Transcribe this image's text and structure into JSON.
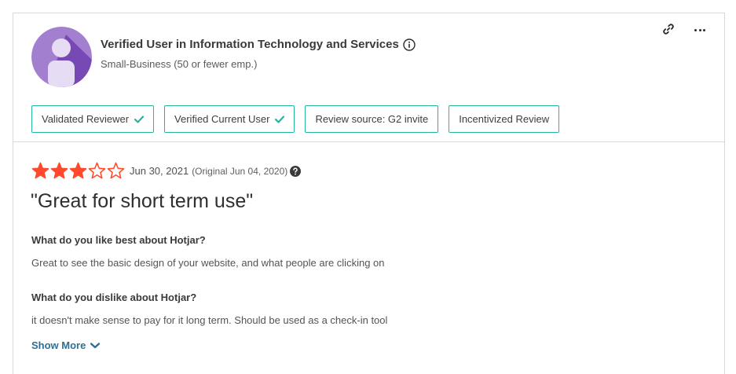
{
  "reviewer": {
    "name": "Verified User in Information Technology and Services",
    "segment": "Small-Business (50 or fewer emp.)"
  },
  "badges": [
    {
      "label": "Validated Reviewer",
      "checked": true
    },
    {
      "label": "Verified Current User",
      "checked": true
    },
    {
      "label": "Review source: G2 invite",
      "checked": false
    },
    {
      "label": "Incentivized Review",
      "checked": false
    }
  ],
  "review": {
    "rating": 3,
    "max_rating": 5,
    "date": "Jun 30, 2021",
    "original_date": "(Original Jun 04, 2020)",
    "title": "\"Great for short term use\"",
    "q_like": "What do you like best about Hotjar?",
    "a_like": "Great to see the basic design of your website, and what people are clicking on",
    "q_dislike": "What do you dislike about Hotjar?",
    "a_dislike": "it doesn't make sense to pay for it long term. Should be used as a check-in tool",
    "show_more_label": "Show More"
  },
  "colors": {
    "star": "#ff492c",
    "badge_border": "#27b49e",
    "check": "#27b49e",
    "link": "#2f6f94",
    "avatar_bg": "#a37fd0",
    "avatar_shadow": "#6f3fb0",
    "avatar_figure": "#e6dcf3"
  },
  "icons": {
    "info": "info-circle-icon",
    "link": "link-icon",
    "more": "more-horizontal-icon",
    "check": "checkmark-icon",
    "star": "star-icon",
    "help": "question-circle-icon",
    "chevron": "chevron-down-icon"
  }
}
